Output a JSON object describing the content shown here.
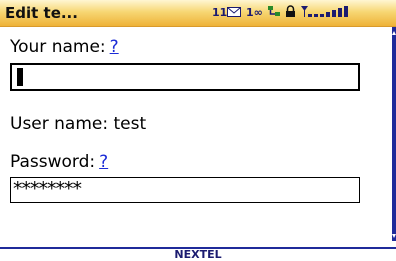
{
  "titlebar": {
    "title": "Edit te...",
    "message_count": "11",
    "mail_icon": "envelope-icon",
    "data_indicator": "1∞",
    "network_icon": "network-icon",
    "lock_icon": "lock-icon",
    "signal_icon": "signal-strength-icon"
  },
  "form": {
    "your_name_label": "Your name:",
    "your_name_help": "?",
    "your_name_value": "",
    "username_text": "User name: test",
    "password_label": "Password:",
    "password_help": "?",
    "password_value": "********"
  },
  "footer": {
    "carrier": "NEXTEL"
  },
  "colors": {
    "accent": "#1f2a9a",
    "titlebar": "#f7d774"
  }
}
